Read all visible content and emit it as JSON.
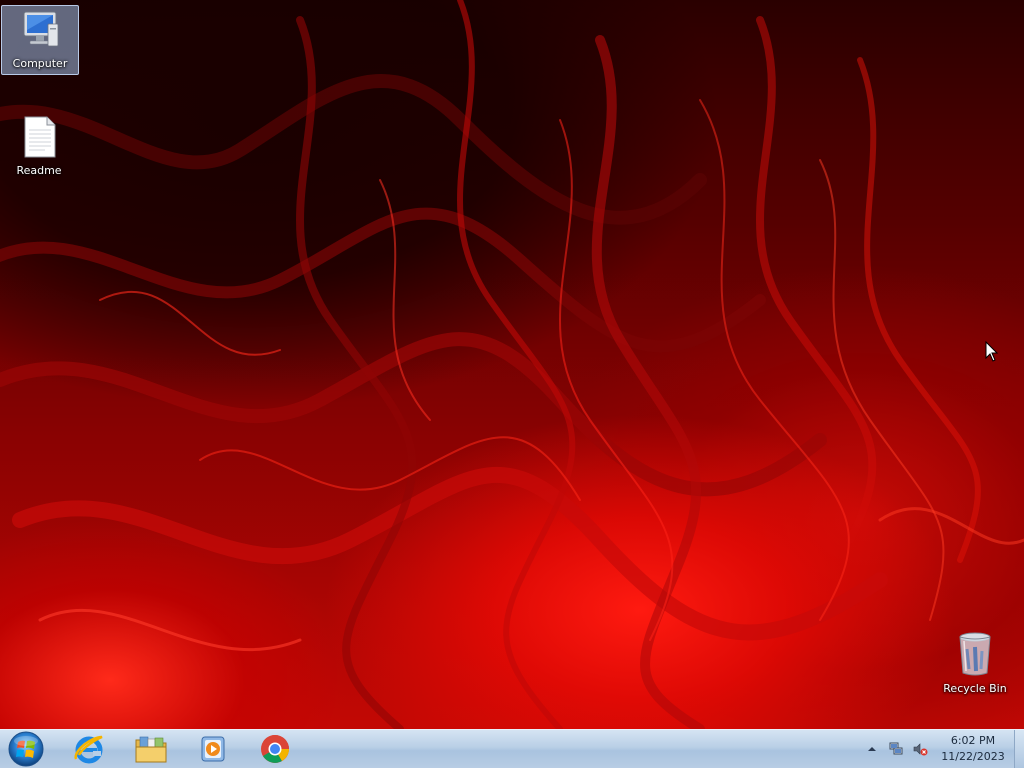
{
  "desktop": {
    "icons": [
      {
        "label": "Computer",
        "icon": "computer-icon",
        "selected": true
      },
      {
        "label": "Readme",
        "icon": "text-document-icon",
        "selected": false
      },
      {
        "label": "Recycle Bin",
        "icon": "recycle-bin-icon",
        "selected": false
      }
    ]
  },
  "taskbar": {
    "start": {
      "icon": "windows-start-orb-icon"
    },
    "pinned": [
      {
        "name": "Internet Explorer",
        "icon": "internet-explorer-icon"
      },
      {
        "name": "Windows Explorer",
        "icon": "folder-library-icon"
      },
      {
        "name": "Windows Media Player",
        "icon": "media-player-icon"
      },
      {
        "name": "Google Chrome",
        "icon": "chrome-icon"
      }
    ],
    "tray": {
      "icons": [
        "show-hidden-icons-arrow",
        "network-icon",
        "volume-muted-icon"
      ],
      "time": "6:02 PM",
      "date": "11/22/2023"
    }
  },
  "colors": {
    "wallpaper_accent": "#e00a06",
    "taskbar": "#b9cfe6",
    "selection": "#a0bee6"
  }
}
